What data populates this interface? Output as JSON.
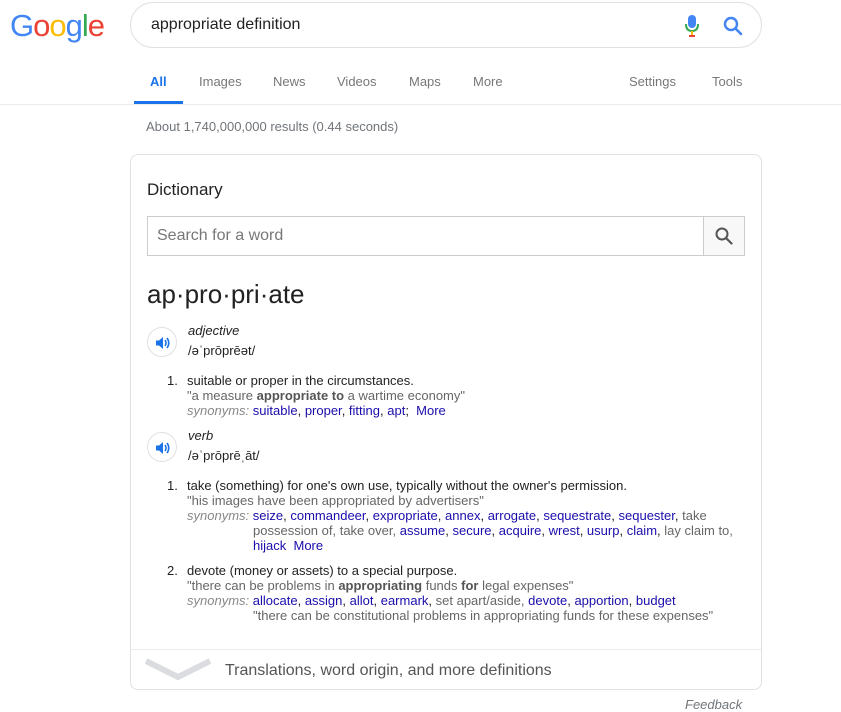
{
  "logo": {
    "letters": [
      "G",
      "o",
      "o",
      "g",
      "l",
      "e"
    ],
    "colors": [
      "#4285f4",
      "#ea4335",
      "#fbbc05",
      "#4285f4",
      "#34a853",
      "#ea4335"
    ]
  },
  "search": {
    "query": "appropriate definition"
  },
  "tabs": {
    "items": [
      {
        "label": "All",
        "active": true
      },
      {
        "label": "Images"
      },
      {
        "label": "News"
      },
      {
        "label": "Videos"
      },
      {
        "label": "Maps"
      },
      {
        "label": "More"
      }
    ],
    "settings": "Settings",
    "tools": "Tools"
  },
  "stats": "About 1,740,000,000 results (0.44 seconds)",
  "dictionary": {
    "title": "Dictionary",
    "search_placeholder": "Search for a word",
    "headword": "ap·pro·pri·ate",
    "entries": [
      {
        "pos": "adjective",
        "phonetic": "/əˈprōprēət/",
        "senses": [
          {
            "num": "1.",
            "definition": "suitable or proper in the circumstances.",
            "example_pre": "\"a measure ",
            "example_bold": "appropriate to",
            "example_post": " a wartime economy\"",
            "synonyms_label": "synonyms:",
            "synonyms": [
              "suitable",
              "proper",
              "fitting",
              "apt"
            ],
            "more": "More"
          }
        ]
      },
      {
        "pos": "verb",
        "phonetic": "/əˈprōprēˌāt/",
        "senses": [
          {
            "num": "1.",
            "definition": "take (something) for one's own use, typically without the owner's permission.",
            "example": "\"his images have been appropriated by advertisers\"",
            "synonyms_label": "synonyms:",
            "synonyms_line1": [
              "seize",
              "commandeer",
              "expropriate",
              "annex",
              "arrogate",
              "sequestrate",
              "sequester"
            ],
            "plain_take": "take",
            "line2_plain": "possession of, take over,",
            "synonyms_line2": [
              "assume",
              "secure",
              "acquire",
              "wrest",
              "usurp",
              "claim"
            ],
            "plain_claim": "lay claim to,",
            "synonyms_line3": [
              "hijack"
            ],
            "more": "More"
          },
          {
            "num": "2.",
            "definition": "devote (money or assets) to a special purpose.",
            "example_pre": "\"there can be problems in ",
            "example_bold1": "appropriating",
            "example_mid": " funds ",
            "example_bold2": "for",
            "example_post": " legal expenses\"",
            "synonyms_label": "synonyms:",
            "synonyms_a": [
              "allocate",
              "assign",
              "allot",
              "earmark"
            ],
            "plain_mid": "set apart/aside,",
            "synonyms_b": [
              "devote",
              "apportion",
              "budget"
            ],
            "syn_example": "\"there can be constitutional problems in appropriating funds for these expenses\""
          }
        ]
      }
    ],
    "footer": "Translations, word origin, and more definitions"
  },
  "feedback": "Feedback"
}
